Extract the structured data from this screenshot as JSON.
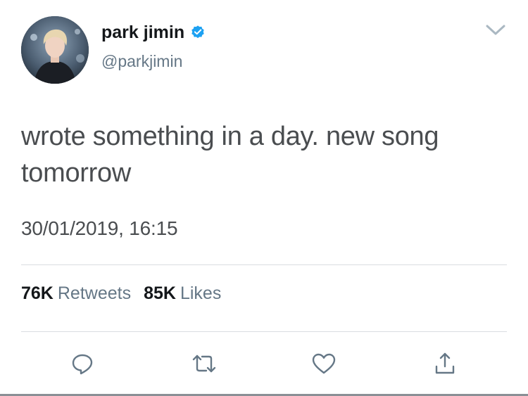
{
  "user": {
    "display_name": "park jimin",
    "handle": "@parkjimin",
    "verified": true
  },
  "tweet": {
    "text": "wrote something in a day. new song tomorrow",
    "timestamp": "30/01/2019, 16:15"
  },
  "stats": {
    "retweets_count": "76K",
    "retweets_label": "Retweets",
    "likes_count": "85K",
    "likes_label": "Likes"
  },
  "actions": [
    "reply-icon",
    "retweet-icon",
    "like-icon",
    "share-icon"
  ],
  "colors": {
    "verified_blue": "#1da1f2",
    "icon_gray": "#657786",
    "text_dark": "#14171a",
    "text_muted": "#657786",
    "divider": "#d9dde1"
  }
}
